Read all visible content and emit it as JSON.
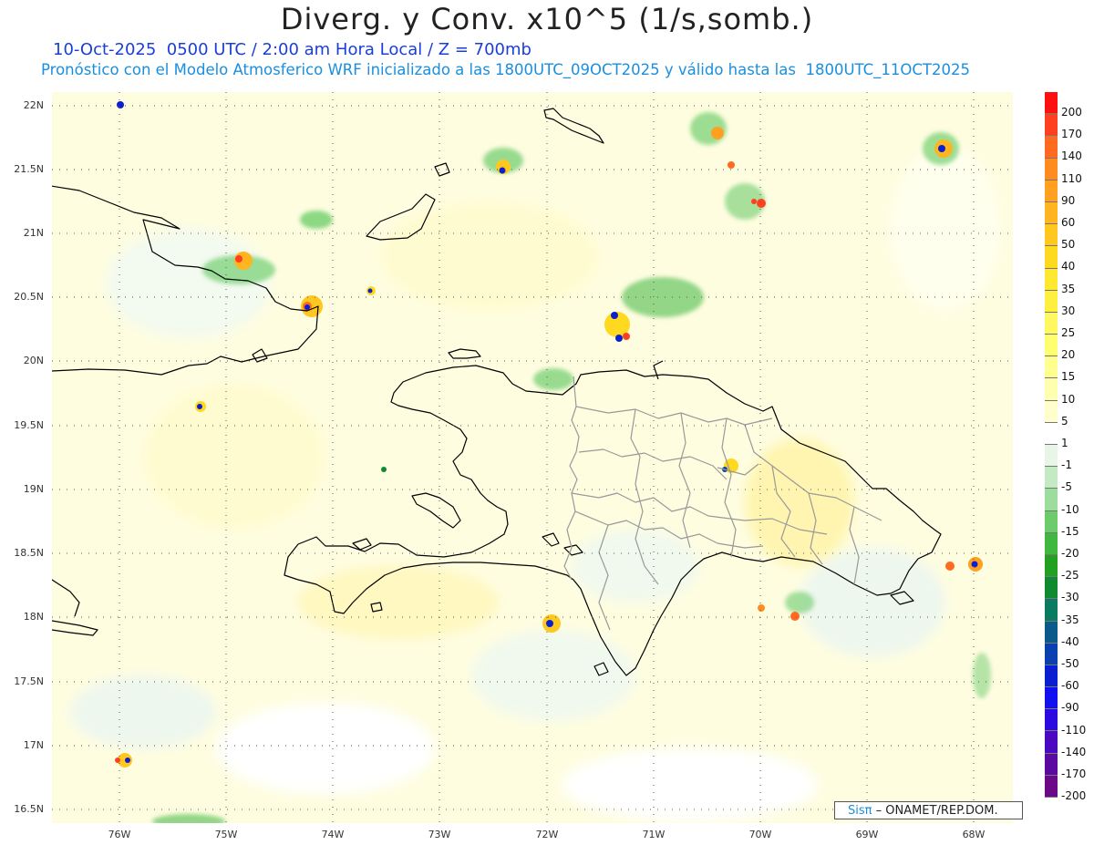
{
  "header": {
    "title": "Diverg. y Conv. x10^5 (1/s,somb.)",
    "subtitle_line1": "10-Oct-2025  0500 UTC / 2:00 am Hora Local / Z = 700mb",
    "subtitle_line2": "Pronóstico con el Modelo Atmosferico WRF inicializado a las 1800UTC_09OCT2025 y válido hasta las  1800UTC_11OCT2025"
  },
  "map": {
    "lat_labels": [
      "22N",
      "21.5N",
      "21N",
      "20.5N",
      "20N",
      "19.5N",
      "19N",
      "18.5N",
      "18N",
      "17.5N",
      "17N",
      "16.5N"
    ],
    "lon_labels": [
      "76W",
      "75W",
      "74W",
      "73W",
      "72W",
      "71W",
      "70W",
      "69W",
      "68W"
    ],
    "lon_range": [
      -76.6,
      -67.6
    ],
    "lat_range": [
      16.45,
      22.1
    ]
  },
  "colorbar": {
    "labels": [
      "200",
      "170",
      "140",
      "110",
      "90",
      "60",
      "50",
      "40",
      "35",
      "30",
      "25",
      "20",
      "15",
      "10",
      "5",
      "1",
      "-1",
      "-5",
      "-10",
      "-15",
      "-20",
      "-25",
      "-30",
      "-35",
      "-40",
      "-50",
      "-60",
      "-90",
      "-110",
      "-140",
      "-170",
      "-200"
    ],
    "colors": [
      "#ff1010",
      "#ff4020",
      "#ff6a20",
      "#ff8c20",
      "#ffa020",
      "#ffb420",
      "#ffc820",
      "#ffd820",
      "#ffe830",
      "#fff040",
      "#fff860",
      "#ffff70",
      "#ffff90",
      "#ffffb0",
      "#ffffcc",
      "#ffffff",
      "#e8f6e8",
      "#c4eac4",
      "#9cdc9c",
      "#6ccc6c",
      "#40b840",
      "#22a022",
      "#108a30",
      "#0a7a60",
      "#0a5a8a",
      "#0a40b0",
      "#0a20d0",
      "#1010f0",
      "#2a0ae0",
      "#4a08c0",
      "#5a0aa0",
      "#6a0a88"
    ]
  },
  "footer": {
    "brand_logo": "Sisπ",
    "brand_text": " – ONAMET/REP.DOM."
  }
}
